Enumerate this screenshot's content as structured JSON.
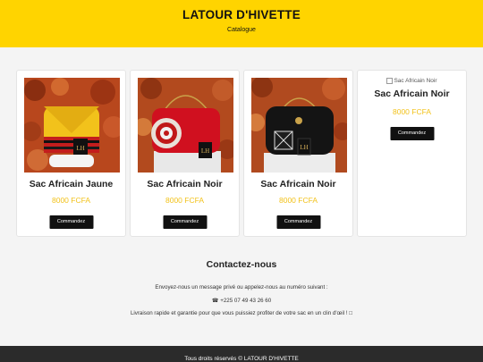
{
  "header": {
    "title": "LATOUR D'HIVETTE",
    "subtitle": "Catalogue"
  },
  "products": [
    {
      "title": "Sac Africain Jaune",
      "price": "8000 FCFA",
      "button": "Commandez",
      "image_alt": "Sac Africain Jaune"
    },
    {
      "title": "Sac Africain Noir",
      "price": "8000 FCFA",
      "button": "Commandez",
      "image_alt": "Sac Africain Noir"
    },
    {
      "title": "Sac Africain Noir",
      "price": "8000 FCFA",
      "button": "Commandez",
      "image_alt": "Sac Africain Noir"
    },
    {
      "title": "Sac Africain Noir",
      "price": "8000 FCFA",
      "button": "Commandez",
      "image_alt": "Sac Africain Noir"
    }
  ],
  "contact": {
    "title": "Contactez-nous",
    "line1": "Envoyez-nous un message privé ou appelez-nous au numéro suivant :",
    "phone": "☎ +225 07 49 43 26 60",
    "line3": "Livraison rapide et garantie pour que vous puissiez profiter de votre sac en un clin d'œil ! □"
  },
  "footer": {
    "text": "Tous droits réservés © LATOUR D'HIVETTE"
  },
  "colors": {
    "accent": "#ffd400",
    "price": "#f2c21b",
    "button": "#111111",
    "footer": "#2b2b2b"
  }
}
